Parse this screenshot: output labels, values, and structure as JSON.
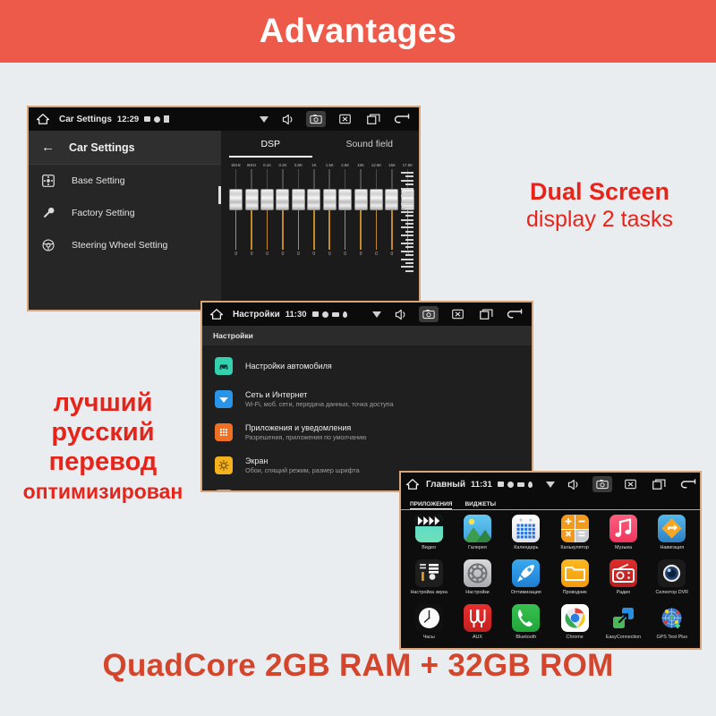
{
  "banner": {
    "title": "Advantages",
    "bg": "#ee5a4a",
    "fg": "#ffffff"
  },
  "promos": {
    "dual_line1": "Dual Screen",
    "dual_line2": "display 2 tasks",
    "russian": [
      "лучший",
      "русский",
      "перевод",
      "оптимизирован"
    ],
    "bottom": "QuadCore 2GB RAM + 32GB ROM",
    "accent": "#e8241a",
    "bottom_color": "#d4452c"
  },
  "screen1": {
    "statusbar": {
      "home_icon": "home-icon",
      "title": "Car Settings",
      "time": "12:29",
      "mini_icons": [
        "sd-card-icon",
        "record-dot-icon",
        "play-triangle-icon"
      ],
      "right_icons": [
        "location-pin-icon",
        "wifi-icon",
        "volume-icon",
        "screenshot-icon",
        "close-x-icon",
        "recents-icon",
        "back-icon"
      ],
      "selected_right_icon": "screenshot-icon"
    },
    "left_panel": {
      "back_icon": "arrow-left-icon",
      "header": "Car Settings",
      "items": [
        {
          "label": "Base Setting",
          "icon": "gear-square-icon"
        },
        {
          "label": "Factory Setting",
          "icon": "wrench-icon"
        },
        {
          "label": "Steering Wheel Setting",
          "icon": "steering-wheel-icon"
        }
      ]
    },
    "right_panel": {
      "tabs": [
        {
          "label": "DSP",
          "active": true
        },
        {
          "label": "Sound field",
          "active": false
        }
      ],
      "equalizer": {
        "bands": [
          "60Hz",
          "80Hz",
          "0.1K",
          "0.2K",
          "0.5K",
          "1K",
          "1.5K",
          "2.5K",
          "10K",
          "12.5K",
          "15K",
          "17.5K"
        ],
        "values": [
          "0",
          "0",
          "0",
          "0",
          "0",
          "0",
          "0",
          "0",
          "0",
          "0",
          "0",
          "0"
        ]
      }
    }
  },
  "screen2": {
    "statusbar": {
      "home_icon": "home-icon",
      "title": "Настройки",
      "time": "11:30",
      "mini_icons": [
        "sd-card-icon",
        "record-dot-icon",
        "usb-icon",
        "bluetooth-icon"
      ],
      "right_icons": [
        "location-pin-icon",
        "wifi-icon",
        "volume-icon",
        "screenshot-icon",
        "close-x-icon",
        "recents-icon",
        "back-icon"
      ],
      "selected_right_icon": "screenshot-icon"
    },
    "subheader": "Настройки",
    "items": [
      {
        "title": "Настройки автомобиля",
        "desc": "",
        "icon": "car-icon",
        "color": "#35d0ae"
      },
      {
        "title": "Сеть и Интернет",
        "desc": "Wi-Fi, моб. сети, передача данных, точка доступа",
        "icon": "wifi-icon",
        "color": "#2a95e8"
      },
      {
        "title": "Приложения и уведомления",
        "desc": "Разрешения, приложения по умолчанию",
        "icon": "apps-grid-icon",
        "color": "#ef7024"
      },
      {
        "title": "Экран",
        "desc": "Обои, спящий режим, размер шрифта",
        "icon": "brightness-icon",
        "color": "#f5b21c"
      },
      {
        "title": "",
        "desc": "",
        "icon": "sound-icon",
        "color": "#35d0ae"
      }
    ]
  },
  "screen3": {
    "statusbar": {
      "home_icon": "home-icon",
      "title": "Главный",
      "time": "11:31",
      "mini_icons": [
        "sd-card-icon",
        "record-dot-icon",
        "usb-icon",
        "bluetooth-icon"
      ],
      "right_icons": [
        "location-pin-icon",
        "wifi-icon",
        "volume-icon",
        "screenshot-icon",
        "close-x-icon",
        "recents-icon",
        "back-icon"
      ],
      "selected_right_icon": "screenshot-icon"
    },
    "tabs": [
      {
        "label": "ПРИЛОЖЕНИЯ",
        "active": true
      },
      {
        "label": "ВИДЖЕТЫ",
        "active": false
      }
    ],
    "apps": [
      [
        {
          "name": "Видео",
          "icon": "video-clapper-icon"
        },
        {
          "name": "Галерея",
          "icon": "gallery-icon"
        },
        {
          "name": "Календарь",
          "icon": "calendar-icon"
        },
        {
          "name": "Калькулятор",
          "icon": "calculator-icon"
        },
        {
          "name": "Музыка",
          "icon": "music-note-icon"
        },
        {
          "name": "Навигация",
          "icon": "navigation-arrow-icon"
        }
      ],
      [
        {
          "name": "Настройка звука",
          "icon": "sound-mixer-icon"
        },
        {
          "name": "Настройки",
          "icon": "settings-gear-icon"
        },
        {
          "name": "Оптимизация",
          "icon": "rocket-icon"
        },
        {
          "name": "Проводник",
          "icon": "folder-icon"
        },
        {
          "name": "Радио",
          "icon": "radio-icon"
        },
        {
          "name": "Селектор DVR",
          "icon": "camera-lens-icon"
        }
      ],
      [
        {
          "name": "Часы",
          "icon": "clock-icon"
        },
        {
          "name": "AUX",
          "icon": "aux-cable-icon"
        },
        {
          "name": "Bluetooth",
          "icon": "phone-handset-icon"
        },
        {
          "name": "Chrome",
          "icon": "chrome-icon"
        },
        {
          "name": "EasyConnection",
          "icon": "screen-mirror-icon"
        },
        {
          "name": "GPS Test Plus",
          "icon": "gps-radar-icon"
        }
      ]
    ]
  }
}
